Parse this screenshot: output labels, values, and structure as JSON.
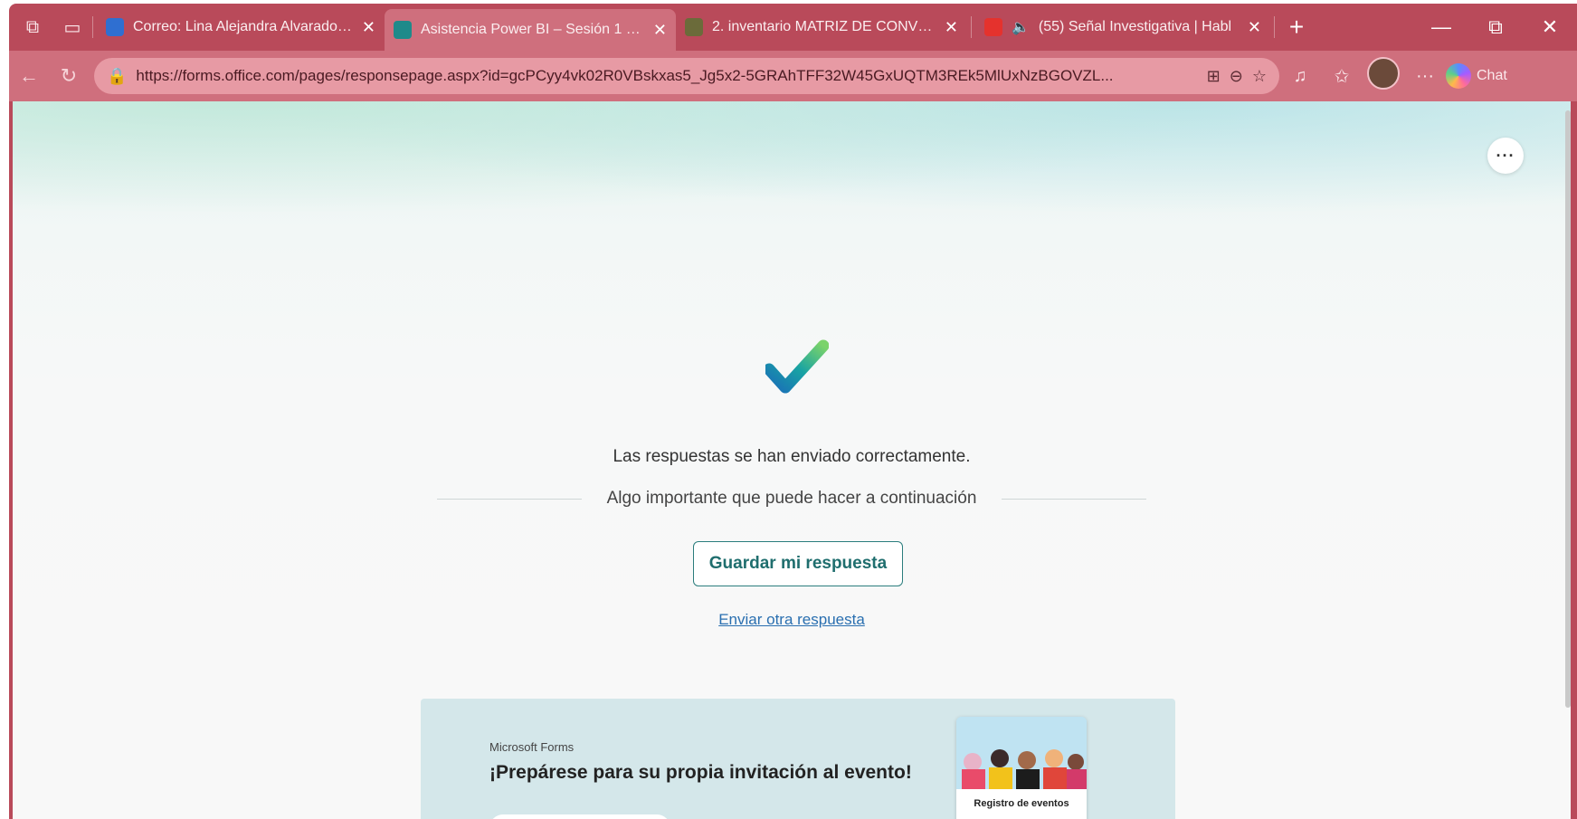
{
  "tabs": [
    {
      "title": "Correo: Lina Alejandra Alvarado Fr",
      "favicon_color": "#2f6fd1"
    },
    {
      "title": "Asistencia Power BI – Sesión 1 (2 d",
      "favicon_color": "#1f8a8a"
    },
    {
      "title": "2. inventario MATRIZ DE CONVENI",
      "favicon_color": "#6b6b3a"
    },
    {
      "title": "(55) Señal Investigativa | Habl",
      "favicon_color": "#e5322d"
    }
  ],
  "toolbar": {
    "url": "https://forms.office.com/pages/responsepage.aspx?id=gcPCyy4vk02R0VBskxas5_Jg5x2-5GRAhTFF32W45GxUQTM3REk5MlUxNzBGOVZL...",
    "copilot_label": "Chat"
  },
  "page": {
    "success_message": "Las respuestas se han enviado correctamente.",
    "next_step": "Algo importante que puede hacer a continuación",
    "save_button": "Guardar mi respuesta",
    "another_link": "Enviar otra respuesta",
    "more_button": "···"
  },
  "promo": {
    "brand": "Microsoft Forms",
    "headline": "¡Prepárese para su propia invitación al evento!",
    "card_label": "Registro de eventos"
  },
  "colors": {
    "frame": "#b94a5a",
    "accent": "#1f6e6e",
    "link": "#2a6fb0"
  }
}
